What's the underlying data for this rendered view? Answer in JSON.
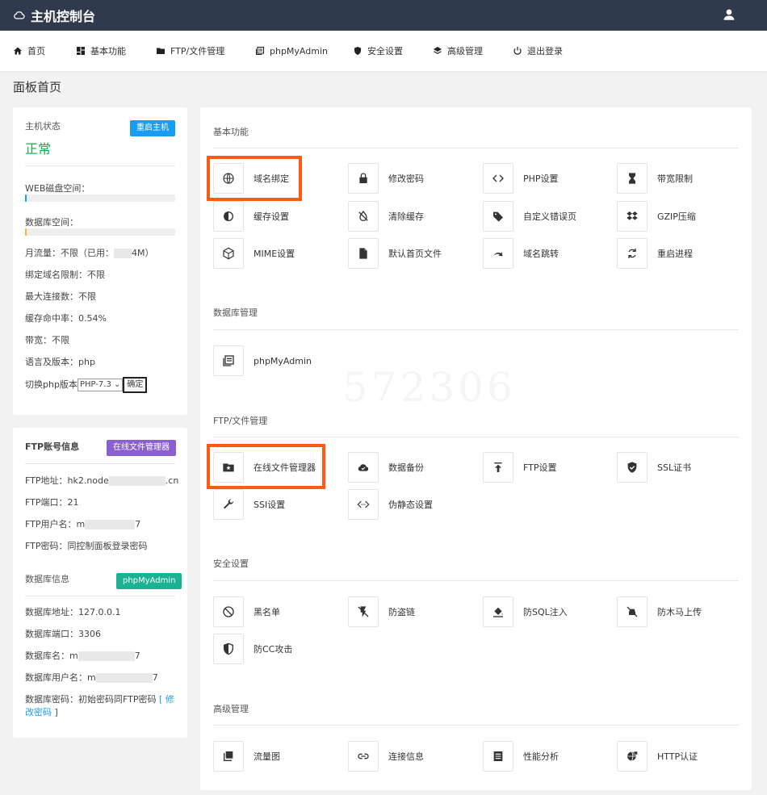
{
  "app": {
    "title": "主机控制台"
  },
  "nav": [
    {
      "label": "首页",
      "icon": "home-icon"
    },
    {
      "label": "基本功能",
      "icon": "grid-icon"
    },
    {
      "label": "FTP/文件管理",
      "icon": "folder-icon"
    },
    {
      "label": "phpMyAdmin",
      "icon": "list-icon"
    },
    {
      "label": "安全设置",
      "icon": "shield-icon"
    },
    {
      "label": "高级管理",
      "icon": "layers-icon"
    },
    {
      "label": "退出登录",
      "icon": "power-icon"
    }
  ],
  "page": {
    "title": "面板首页"
  },
  "host": {
    "status_label": "主机状态",
    "status_value": "正常",
    "restart_label": "重启主机",
    "web_disk_label": "WEB磁盘空间：",
    "web_disk_percent": 1,
    "db_space_label": "数据库空间：",
    "db_space_percent": 1,
    "traffic": "月流量：不限（已用：",
    "traffic_tail": "4M）",
    "domain_limit": "绑定域名限制：不限",
    "max_conn": "最大连接数：不限",
    "cache_hit": "缓存命中率：0.54%",
    "bandwidth": "带宽：不限",
    "lang": "语言及版本：php",
    "switch_label": "切换php版本",
    "php_selected": "PHP-7.3",
    "confirm_label": "确定"
  },
  "ftp": {
    "title": "FTP账号信息",
    "manager_label": "在线文件管理器",
    "addr_prefix": "FTP地址：hk2.node",
    "addr_suffix": ".cn",
    "port": "FTP端口：21",
    "user_prefix": "FTP用户名：m",
    "user_suffix": "7",
    "password": "FTP密码：同控制面板登录密码"
  },
  "db": {
    "title": "数据库信息",
    "pma_label": "phpMyAdmin",
    "addr": "数据库地址：127.0.0.1",
    "port": "数据库端口：3306",
    "name_prefix": "数据库名：m",
    "name_suffix": "7",
    "user_prefix": "数据库用户名：m",
    "user_suffix": "7",
    "pwd_text": "数据库密码：初始密码同FTP密码",
    "pwd_link1": "修",
    "pwd_link2": "改密码",
    "bracket_open": "[",
    "bracket_close": "]"
  },
  "sections": {
    "basic": {
      "title": "基本功能",
      "items": [
        {
          "label": "域名绑定",
          "icon": "globe-icon"
        },
        {
          "label": "修改密码",
          "icon": "lock-icon"
        },
        {
          "label": "PHP设置",
          "icon": "code-icon"
        },
        {
          "label": "带宽限制",
          "icon": "hourglass-icon"
        },
        {
          "label": "缓存设置",
          "icon": "contrast-icon"
        },
        {
          "label": "清除缓存",
          "icon": "no-drop-icon"
        },
        {
          "label": "自定义错误页",
          "icon": "tag-icon"
        },
        {
          "label": "GZIP压缩",
          "icon": "dropbox-icon"
        },
        {
          "label": "MIME设置",
          "icon": "cube-icon"
        },
        {
          "label": "默认首页文件",
          "icon": "file-icon"
        },
        {
          "label": "域名跳转",
          "icon": "redo-icon"
        },
        {
          "label": "重启进程",
          "icon": "refresh-icon"
        }
      ]
    },
    "database": {
      "title": "数据库管理",
      "items": [
        {
          "label": "phpMyAdmin",
          "icon": "list-icon"
        }
      ]
    },
    "ftp": {
      "title": "FTP/文件管理",
      "items": [
        {
          "label": "在线文件管理器",
          "icon": "folder-star-icon"
        },
        {
          "label": "数据备份",
          "icon": "cloud-check-icon"
        },
        {
          "label": "FTP设置",
          "icon": "upload-icon"
        },
        {
          "label": "SSL证书",
          "icon": "shield-check-icon"
        },
        {
          "label": "SSI设置",
          "icon": "wrench-icon"
        },
        {
          "label": "伪静态设置",
          "icon": "code-dots-icon"
        }
      ]
    },
    "security": {
      "title": "安全设置",
      "items": [
        {
          "label": "黑名单",
          "icon": "block-icon"
        },
        {
          "label": "防盗链",
          "icon": "flash-off-icon"
        },
        {
          "label": "防SQL注入",
          "icon": "paint-bucket-icon"
        },
        {
          "label": "防木马上传",
          "icon": "bug-off-icon"
        },
        {
          "label": "防CC攻击",
          "icon": "shield-half-icon"
        }
      ]
    },
    "advanced": {
      "title": "高级管理",
      "items": [
        {
          "label": "流量图",
          "icon": "library-icon"
        },
        {
          "label": "连接信息",
          "icon": "link-icon"
        },
        {
          "label": "性能分析",
          "icon": "list-box-icon"
        },
        {
          "label": "HTTP认证",
          "icon": "globe-lock-icon"
        }
      ]
    }
  },
  "watermark": "572306",
  "colors": {
    "topbar": "#2f3b4c",
    "accent": "#1a9cf1",
    "highlight": "#ff5b12",
    "status_ok": "#1aa94c"
  }
}
